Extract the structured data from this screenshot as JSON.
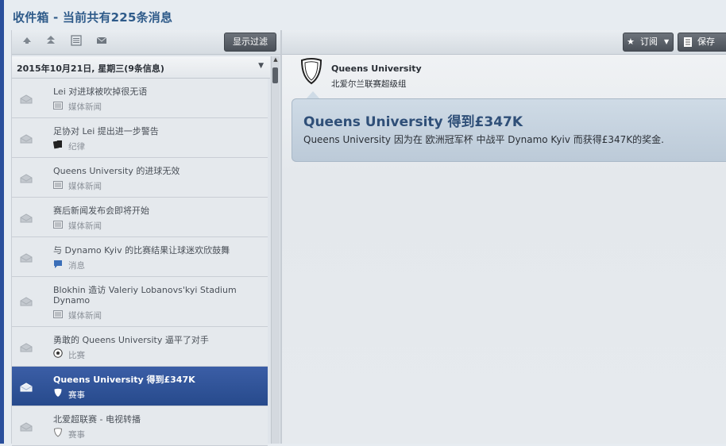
{
  "title": "收件箱 - 当前共有225条消息",
  "left_toolbar": {
    "icons": [
      "arrow-up-icon",
      "double-arrow-up-icon",
      "list-icon",
      "envelope-icon"
    ],
    "filter_button": "显示过滤"
  },
  "date_group": {
    "label": "2015年10月21日, 星期三(9条信息)"
  },
  "messages": [
    {
      "subject": "Lei 对进球被吹掉很无语",
      "category": "媒体新闻",
      "icon": "newspaper-icon"
    },
    {
      "subject": "足协对 Lei 提出进一步警告",
      "category": "纪律",
      "icon": "cards-icon"
    },
    {
      "subject": "Queens University 的进球无效",
      "category": "媒体新闻",
      "icon": "newspaper-icon"
    },
    {
      "subject": "赛后新闻发布会即将开始",
      "category": "媒体新闻",
      "icon": "newspaper-icon"
    },
    {
      "subject": "与 Dynamo Kyiv 的比赛结果让球迷欢欣鼓舞",
      "category": "消息",
      "icon": "speech-bubble-icon"
    },
    {
      "subject_line1": "Blokhin 造访 Valeriy Lobanovs'kyi Stadium",
      "subject_line2": "Dynamo",
      "category": "媒体新闻",
      "icon": "newspaper-icon"
    },
    {
      "subject": "勇敢的 Queens University 逼平了对手",
      "category": "比赛",
      "icon": "football-icon"
    },
    {
      "subject": "Queens University 得到£347K",
      "category": "赛事",
      "icon": "shield-icon",
      "selected": true
    },
    {
      "subject": "北爱超联赛 - 电视转播",
      "category": "赛事",
      "icon": "shield-outline-icon"
    }
  ],
  "right_toolbar": {
    "subscribe_button": "订阅",
    "save_button": "保存"
  },
  "detail": {
    "club_name": "Queens University",
    "league": "北爱尔兰联赛超级组",
    "headline": "Queens University 得到£347K",
    "body": "Queens University 因为在 欧洲冠军杯 中战平 Dynamo Kyiv 而获得£347K的奖金."
  },
  "colors": {
    "accent": "#2a4f9c",
    "selected_row": "#2f5296",
    "bubble": "#c8d5e1",
    "title_text": "#2f5b8a"
  }
}
